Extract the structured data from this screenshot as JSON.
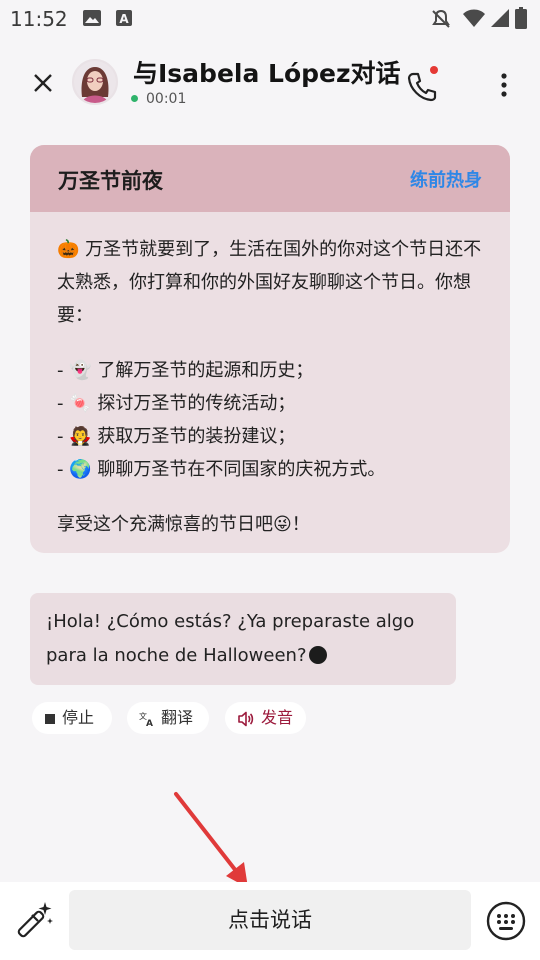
{
  "status_bar": {
    "time": "11:52",
    "icons": [
      "image-icon",
      "a-box-icon",
      "mute-icon",
      "wifi-icon",
      "signal-icon",
      "battery-icon"
    ]
  },
  "header": {
    "title": "与Isabela López对话",
    "call_timer": "00:01",
    "online_color": "#2fb36b",
    "notification_dot_color": "#e53935"
  },
  "card": {
    "title": "万圣节前夜",
    "link": "练前热身",
    "intro": "🎃 万圣节就要到了，生活在国外的你对这个节日还不太熟悉，你打算和你的外国好友聊聊这个节日。你想要：",
    "items": [
      "- 👻 了解万圣节的起源和历史；",
      "- 🍬 探讨万圣节的传统活动；",
      "- 🧛 获取万圣节的装扮建议；",
      "- 🌍 聊聊万圣节在不同国家的庆祝方式。"
    ],
    "outro": "享受这个充满惊喜的节日吧😜！",
    "header_color": "#dab3bb",
    "link_color": "#2f87e6"
  },
  "chat": {
    "message": "¡Hola! ¿Cómo estás? ¿Ya preparaste algo para la noche de Halloween?"
  },
  "actions": {
    "stop": "停止",
    "translate": "翻译",
    "speak": "发音",
    "speak_color": "#9c1b3d"
  },
  "bottom": {
    "talk": "点击说话"
  }
}
